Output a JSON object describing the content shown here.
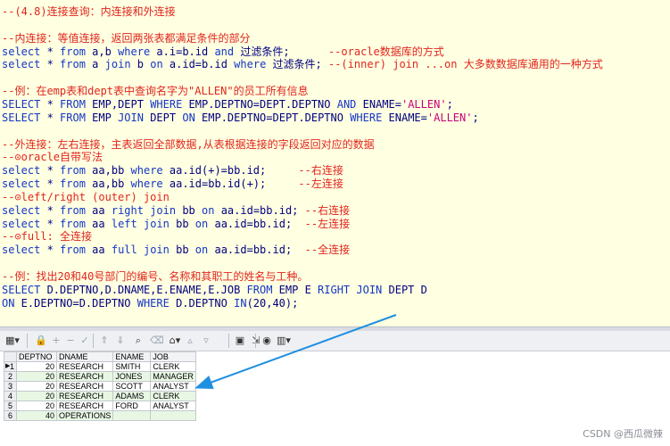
{
  "editor": {
    "lines": [
      [
        {
          "t": "--(4.8)连接查询：内连接和外连接",
          "c": "cmt"
        }
      ],
      [],
      [
        {
          "t": "--内连接：等值连接，返回两张表都满足条件的部分",
          "c": "cmt"
        }
      ],
      [
        {
          "t": "select",
          "c": "kw"
        },
        {
          "t": " * ",
          "c": "id"
        },
        {
          "t": "from",
          "c": "kw"
        },
        {
          "t": " a,b ",
          "c": "id"
        },
        {
          "t": "where",
          "c": "kw"
        },
        {
          "t": " a.i=b.id ",
          "c": "id"
        },
        {
          "t": "and",
          "c": "kw"
        },
        {
          "t": " 过滤条件;      ",
          "c": "id"
        },
        {
          "t": "--oracle数据库的方式",
          "c": "cmt"
        }
      ],
      [
        {
          "t": "select",
          "c": "kw"
        },
        {
          "t": " * ",
          "c": "id"
        },
        {
          "t": "from",
          "c": "kw"
        },
        {
          "t": " a ",
          "c": "id"
        },
        {
          "t": "join",
          "c": "kw"
        },
        {
          "t": " b ",
          "c": "id"
        },
        {
          "t": "on",
          "c": "kw"
        },
        {
          "t": " a.id=b.id ",
          "c": "id"
        },
        {
          "t": "where",
          "c": "kw"
        },
        {
          "t": " 过滤条件; ",
          "c": "id"
        },
        {
          "t": "--(inner) join ...on 大多数数据库通用的一种方式",
          "c": "cmt"
        }
      ],
      [],
      [
        {
          "t": "--例：在emp表和dept表中查询名字为\"ALLEN\"的员工所有信息",
          "c": "cmt"
        }
      ],
      [
        {
          "t": "SELECT",
          "c": "kw"
        },
        {
          "t": " * ",
          "c": "id"
        },
        {
          "t": "FROM",
          "c": "kw"
        },
        {
          "t": " EMP,DEPT ",
          "c": "id"
        },
        {
          "t": "WHERE",
          "c": "kw"
        },
        {
          "t": " EMP.DEPTNO=DEPT.DEPTNO ",
          "c": "id"
        },
        {
          "t": "AND",
          "c": "kw"
        },
        {
          "t": " ENAME=",
          "c": "id"
        },
        {
          "t": "'ALLEN'",
          "c": "str"
        },
        {
          "t": ";",
          "c": "id"
        }
      ],
      [
        {
          "t": "SELECT",
          "c": "kw"
        },
        {
          "t": " * ",
          "c": "id"
        },
        {
          "t": "FROM",
          "c": "kw"
        },
        {
          "t": " EMP ",
          "c": "id"
        },
        {
          "t": "JOIN",
          "c": "kw"
        },
        {
          "t": " DEPT ",
          "c": "id"
        },
        {
          "t": "ON",
          "c": "kw"
        },
        {
          "t": " EMP.DEPTNO=DEPT.DEPTNO ",
          "c": "id"
        },
        {
          "t": "WHERE",
          "c": "kw"
        },
        {
          "t": " ENAME=",
          "c": "id"
        },
        {
          "t": "'ALLEN'",
          "c": "str"
        },
        {
          "t": ";",
          "c": "id"
        }
      ],
      [],
      [
        {
          "t": "--外连接：左右连接，主表返回全部数据,从表根据连接的字段返回对应的数据",
          "c": "cmt"
        }
      ],
      [
        {
          "t": "--⊙oracle自带写法",
          "c": "cmt"
        }
      ],
      [
        {
          "t": "select",
          "c": "kw"
        },
        {
          "t": " * ",
          "c": "id"
        },
        {
          "t": "from",
          "c": "kw"
        },
        {
          "t": " aa,bb ",
          "c": "id"
        },
        {
          "t": "where",
          "c": "kw"
        },
        {
          "t": " aa.id(+)=bb.id;     ",
          "c": "id"
        },
        {
          "t": "--右连接",
          "c": "cmt"
        }
      ],
      [
        {
          "t": "select",
          "c": "kw"
        },
        {
          "t": " * ",
          "c": "id"
        },
        {
          "t": "from",
          "c": "kw"
        },
        {
          "t": " aa,bb ",
          "c": "id"
        },
        {
          "t": "where",
          "c": "kw"
        },
        {
          "t": " aa.id=bb.id(+);     ",
          "c": "id"
        },
        {
          "t": "--左连接",
          "c": "cmt"
        }
      ],
      [
        {
          "t": "--⊙left/right (outer) join",
          "c": "cmt"
        }
      ],
      [
        {
          "t": "select",
          "c": "kw"
        },
        {
          "t": " * ",
          "c": "id"
        },
        {
          "t": "from",
          "c": "kw"
        },
        {
          "t": " aa ",
          "c": "id"
        },
        {
          "t": "right join",
          "c": "kw"
        },
        {
          "t": " bb ",
          "c": "id"
        },
        {
          "t": "on",
          "c": "kw"
        },
        {
          "t": " aa.id=bb.id; ",
          "c": "id"
        },
        {
          "t": "--右连接",
          "c": "cmt"
        }
      ],
      [
        {
          "t": "select",
          "c": "kw"
        },
        {
          "t": " * ",
          "c": "id"
        },
        {
          "t": "from",
          "c": "kw"
        },
        {
          "t": " aa ",
          "c": "id"
        },
        {
          "t": "left join",
          "c": "kw"
        },
        {
          "t": " bb ",
          "c": "id"
        },
        {
          "t": "on",
          "c": "kw"
        },
        {
          "t": " aa.id=bb.id;  ",
          "c": "id"
        },
        {
          "t": "--左连接",
          "c": "cmt"
        }
      ],
      [
        {
          "t": "--⊙full: 全连接",
          "c": "cmt"
        }
      ],
      [
        {
          "t": "select",
          "c": "kw"
        },
        {
          "t": " * ",
          "c": "id"
        },
        {
          "t": "from",
          "c": "kw"
        },
        {
          "t": " aa ",
          "c": "id"
        },
        {
          "t": "full join",
          "c": "kw"
        },
        {
          "t": " bb ",
          "c": "id"
        },
        {
          "t": "on",
          "c": "kw"
        },
        {
          "t": " aa.id=bb.id;  ",
          "c": "id"
        },
        {
          "t": "--全连接",
          "c": "cmt"
        }
      ],
      [],
      [
        {
          "t": "--例：找出20和40号部门的编号、名称和其职工的姓名与工种。",
          "c": "cmt"
        }
      ],
      [
        {
          "t": "SELECT",
          "c": "kw"
        },
        {
          "t": " D.DEPTNO,D.DNAME,E.ENAME,E.JOB ",
          "c": "id"
        },
        {
          "t": "FROM",
          "c": "kw"
        },
        {
          "t": " EMP E ",
          "c": "id"
        },
        {
          "t": "RIGHT JOIN",
          "c": "kw"
        },
        {
          "t": " DEPT D",
          "c": "id"
        }
      ],
      [
        {
          "t": "ON",
          "c": "kw"
        },
        {
          "t": " E.DEPTNO=D.DEPTNO ",
          "c": "id"
        },
        {
          "t": "WHERE",
          "c": "kw"
        },
        {
          "t": " D.DEPTNO ",
          "c": "id"
        },
        {
          "t": "IN",
          "c": "kw"
        },
        {
          "t": "(20,40);",
          "c": "id"
        }
      ]
    ]
  },
  "toolbar": {
    "buttons": [
      {
        "name": "grid-icon",
        "glyph": "▦▾",
        "dim": false
      },
      {
        "name": "lock-icon",
        "glyph": "🔒",
        "dim": false
      },
      {
        "name": "add-record-icon",
        "glyph": "+",
        "dim": true
      },
      {
        "name": "delete-record-icon",
        "glyph": "−",
        "dim": true
      },
      {
        "name": "post-record-icon",
        "glyph": "✓",
        "dim": true
      },
      {
        "name": "first-record-icon",
        "glyph": "⇑",
        "dim": true
      },
      {
        "name": "last-record-icon",
        "glyph": "⇓",
        "dim": true
      },
      {
        "name": "binoculars-icon",
        "glyph": "⌕",
        "dim": false
      },
      {
        "name": "clear-icon",
        "glyph": "⌫",
        "dim": true
      },
      {
        "name": "query-by-example-icon",
        "glyph": "⌂▾",
        "dim": false
      },
      {
        "name": "prior-icon",
        "glyph": "▵",
        "dim": true
      },
      {
        "name": "next-icon",
        "glyph": "▿",
        "dim": true
      },
      {
        "name": "save-icon",
        "glyph": "▣",
        "dim": false
      },
      {
        "name": "export-icon",
        "glyph": "⇲",
        "dim": false
      },
      {
        "name": "single-record-view-icon",
        "glyph": "◉",
        "dim": false
      },
      {
        "name": "chart-icon",
        "glyph": "▥▾",
        "dim": false
      }
    ]
  },
  "results": {
    "columns": [
      "DEPTNO",
      "DNAME",
      "ENAME",
      "JOB"
    ],
    "rows": [
      {
        "n": "1",
        "deptno": "20",
        "dname": "RESEARCH",
        "ename": "SMITH",
        "job": "CLERK"
      },
      {
        "n": "2",
        "deptno": "20",
        "dname": "RESEARCH",
        "ename": "JONES",
        "job": "MANAGER"
      },
      {
        "n": "3",
        "deptno": "20",
        "dname": "RESEARCH",
        "ename": "SCOTT",
        "job": "ANALYST"
      },
      {
        "n": "4",
        "deptno": "20",
        "dname": "RESEARCH",
        "ename": "ADAMS",
        "job": "CLERK"
      },
      {
        "n": "5",
        "deptno": "20",
        "dname": "RESEARCH",
        "ename": "FORD",
        "job": "ANALYST"
      },
      {
        "n": "6",
        "deptno": "40",
        "dname": "OPERATIONS",
        "ename": "",
        "job": ""
      }
    ],
    "current_row": "1"
  },
  "watermark": "CSDN @西瓜微辣",
  "colors": {
    "editor_bg": "#ffffe1",
    "comment": "#e0261e",
    "keyword": "#1436c8",
    "string": "#c8007a",
    "arrow": "#1f8fe0",
    "alt_row": "#e8f7e4"
  }
}
